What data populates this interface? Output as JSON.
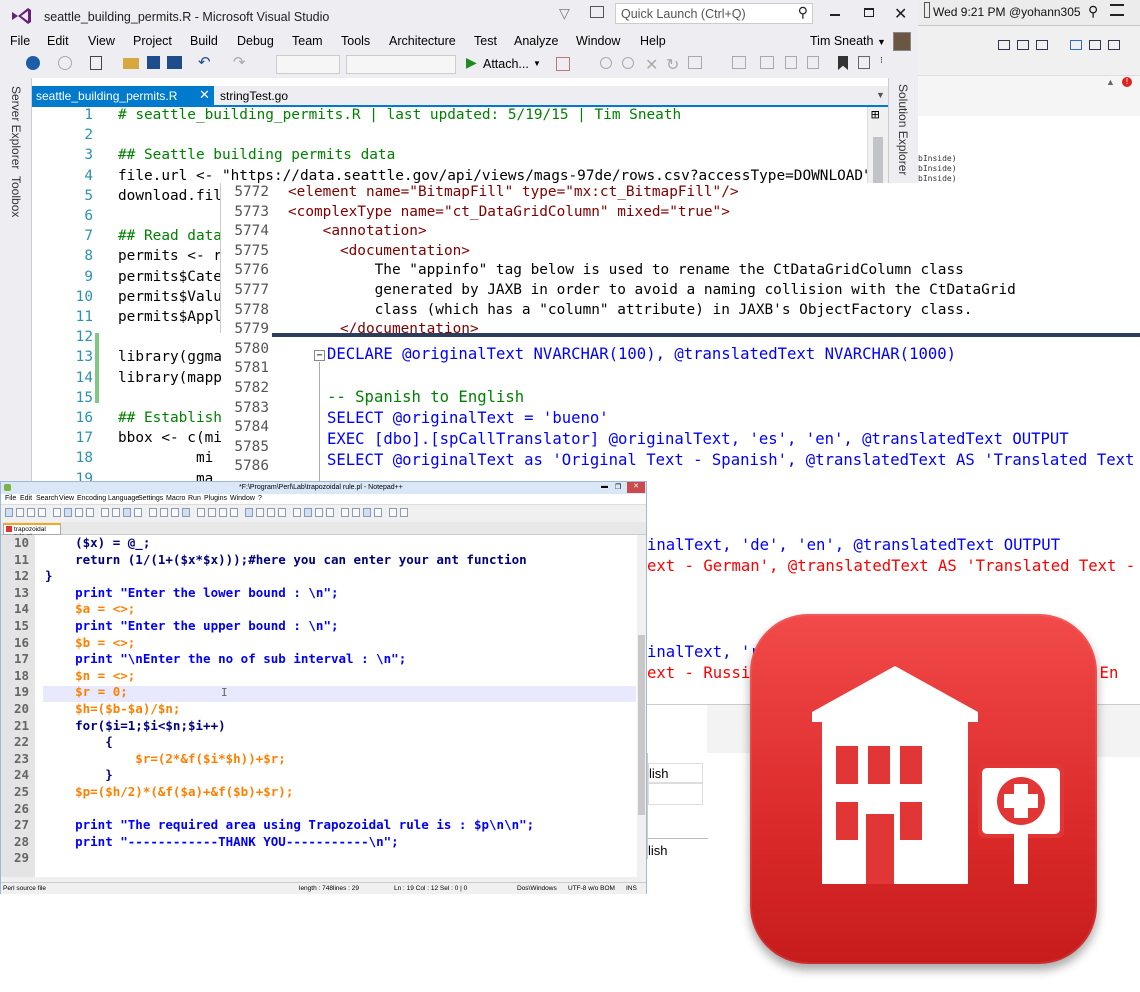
{
  "mac": {
    "datetime": "Wed 9:21 PM",
    "user": "@yohann305"
  },
  "vs": {
    "title": "seattle_building_permits.R - Microsoft Visual Studio",
    "quick_launch": "Quick Launch (Ctrl+Q)",
    "user_name": "Tim Sneath",
    "menu": [
      "File",
      "Edit",
      "View",
      "Project",
      "Build",
      "Debug",
      "Team",
      "Tools",
      "Architecture",
      "Test",
      "Analyze",
      "Window",
      "Help"
    ],
    "attach_label": "Attach...",
    "side_tabs": [
      "Server Explorer",
      "Toolbox"
    ],
    "solution_explorer": "Solution Explorer",
    "tabs": [
      {
        "label": "seattle_building_permits.R",
        "active": true
      },
      {
        "label": "stringTest.go",
        "active": false
      }
    ],
    "right_pane_lines": [
      "bInside)",
      "bInside)",
      "bInside)"
    ],
    "lines": [
      {
        "n": "1",
        "t": "# seattle_building_permits.R | last updated: 5/19/15 | Tim Sneath"
      },
      {
        "n": "2",
        "t": ""
      },
      {
        "n": "3",
        "t": "## Seattle building permits data"
      },
      {
        "n": "4",
        "t": "file.url <- \"https://data.seattle.gov/api/views/mags-97de/rows.csv?accessType=DOWNLOAD\""
      },
      {
        "n": "5",
        "t": "download.fil"
      },
      {
        "n": "6",
        "t": ""
      },
      {
        "n": "7",
        "t": "## Read data"
      },
      {
        "n": "8",
        "t": "permits <- r"
      },
      {
        "n": "9",
        "t": "permits$Cate"
      },
      {
        "n": "10",
        "t": "permits$Valu"
      },
      {
        "n": "11",
        "t": "permits$Appl"
      },
      {
        "n": "12",
        "t": ""
      },
      {
        "n": "13",
        "t": "library(ggma"
      },
      {
        "n": "14",
        "t": "library(mapp"
      },
      {
        "n": "15",
        "t": ""
      },
      {
        "n": "16",
        "t": "## Establish"
      },
      {
        "n": "17",
        "t": "bbox <- c(mi"
      },
      {
        "n": "18",
        "t": "         mi"
      },
      {
        "n": "19",
        "t": "         ma"
      }
    ]
  },
  "xml": {
    "lines": [
      {
        "n": "5772",
        "t": "<element name=\"BitmapFill\" type=\"mx:ct_BitmapFill\"/>"
      },
      {
        "n": "5773",
        "t": "<complexType name=\"ct_DataGridColumn\" mixed=\"true\">"
      },
      {
        "n": "5774",
        "t": "    <annotation>"
      },
      {
        "n": "5775",
        "t": "      <documentation>"
      },
      {
        "n": "5776",
        "t": "          The \"appinfo\" tag below is used to rename the CtDataGridColumn class"
      },
      {
        "n": "5777",
        "t": "          generated by JAXB in order to avoid a naming collision with the CtDataGrid"
      },
      {
        "n": "5778",
        "t": "          class (which has a \"column\" attribute) in JAXB's ObjectFactory class."
      },
      {
        "n": "5779",
        "t": "      </documentation>"
      },
      {
        "n": "5780",
        "t": ""
      },
      {
        "n": "5781",
        "t": ""
      },
      {
        "n": "5782",
        "t": ""
      },
      {
        "n": "5783",
        "t": ""
      },
      {
        "n": "5784",
        "t": ""
      },
      {
        "n": "5785",
        "t": ""
      },
      {
        "n": "5786",
        "t": ""
      }
    ]
  },
  "sql": {
    "l1": "DECLARE @originalText NVARCHAR(100), @translatedText NVARCHAR(1000)",
    "l3": "-- Spanish to English",
    "l4": "SELECT @originalText = 'bueno'",
    "l5": "EXEC [dbo].[spCallTranslator] @originalText, 'es', 'en', @translatedText OUTPUT",
    "l6": "SELECT @originalText as 'Original Text - Spanish', @translatedText AS 'Translated Text - En",
    "l7": "inalText, 'de', 'en', @translatedText OUTPUT",
    "l8": "ext - German', @translatedText AS 'Translated Text - Eng",
    "l9": "inalText, 'ru",
    "l10": "ext - Russian",
    "l10b": "t - En",
    "grid1": "lish",
    "grid2": "lish"
  },
  "npp": {
    "title": "*F:\\Program\\Perl\\Lab\\trapozoidal rule.pl - Notepad++",
    "menu": [
      "File",
      "Edit",
      "Search",
      "View",
      "Encoding",
      "Language",
      "Settings",
      "Macro",
      "Run",
      "Plugins",
      "Window",
      "?"
    ],
    "tab": "trapozoidal rule.pl",
    "status": {
      "type": "Perl source file",
      "length": "length : 748",
      "lines": "lines : 29",
      "pos": "Ln : 19   Col : 12   Sel : 0 | 0",
      "eol": "Dos\\Windows",
      "enc": "UTF-8 w/o BOM",
      "mode": "INS"
    },
    "lines": [
      {
        "n": "10",
        "t": "    ($x) = @_;"
      },
      {
        "n": "11",
        "t": "    return (1/(1+($x*$x)));#here you can enter your ant function"
      },
      {
        "n": "12",
        "t": "}"
      },
      {
        "n": "13",
        "t": "    print \"Enter the lower bound : \\n\";"
      },
      {
        "n": "14",
        "t": "    $a = <>;"
      },
      {
        "n": "15",
        "t": "    print \"Enter the upper bound : \\n\";"
      },
      {
        "n": "16",
        "t": "    $b = <>;"
      },
      {
        "n": "17",
        "t": "    print \"\\nEnter the no of sub interval : \\n\";"
      },
      {
        "n": "18",
        "t": "    $n = <>;"
      },
      {
        "n": "19",
        "t": "    $r = 0;"
      },
      {
        "n": "20",
        "t": "    $h=($b-$a)/$n;"
      },
      {
        "n": "21",
        "t": "    for($i=1;$i<$n;$i++)"
      },
      {
        "n": "22",
        "t": "        {"
      },
      {
        "n": "23",
        "t": "            $r=(2*&f($i*$h))+$r;"
      },
      {
        "n": "24",
        "t": "        }"
      },
      {
        "n": "25",
        "t": "    $p=($h/2)*(&f($a)+&f($b)+$r);"
      },
      {
        "n": "26",
        "t": ""
      },
      {
        "n": "27",
        "t": "    print \"The required area using Trapozoidal rule is : $p\\n\\n\";"
      },
      {
        "n": "28",
        "t": "    print \"------------THANK YOU-----------\\n\";"
      },
      {
        "n": "29",
        "t": ""
      }
    ]
  },
  "colors": {
    "vs_blue": "#007acc",
    "icon_red": "#e23636",
    "npp_keyword": "#0000ff",
    "npp_var": "#ff8000",
    "npp_comment": "#008000",
    "sql_keyword": "#0000ff",
    "sql_string": "#ff0000",
    "sql_comment": "#008000"
  }
}
